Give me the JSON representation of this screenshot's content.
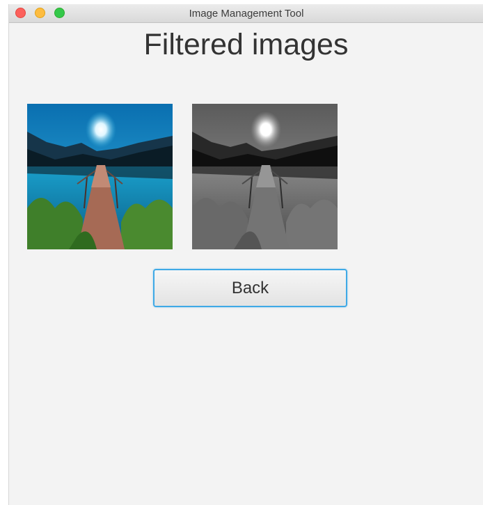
{
  "window": {
    "title": "Image Management Tool",
    "controls": [
      "close",
      "minimize",
      "maximize"
    ]
  },
  "page": {
    "heading": "Filtered images"
  },
  "images": [
    {
      "name": "original-lake-pier-image",
      "style": "color"
    },
    {
      "name": "filtered-lake-pier-image",
      "style": "grayscale"
    }
  ],
  "actions": {
    "back_label": "Back"
  },
  "colors": {
    "focus_ring": "#3fa9e6",
    "window_bg": "#f3f3f3",
    "close": "#fc605c",
    "minimize": "#fdbc40",
    "maximize": "#34c84a"
  }
}
